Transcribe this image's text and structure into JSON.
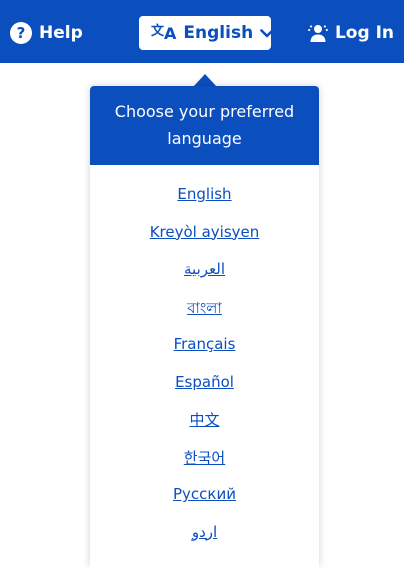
{
  "header": {
    "help_label": "Help",
    "help_icon": "question-circle-icon",
    "language_button_label": "English",
    "language_icon": "translate-icon",
    "login_label": "Log In",
    "login_icon": "user-icon"
  },
  "language_menu": {
    "heading": "Choose your preferred language",
    "languages": [
      "English",
      "Kreyòl ayisyen",
      "العربية",
      "বাংলা",
      "Français",
      "Español",
      "中文",
      "한국어",
      "Русский",
      "اردو"
    ]
  },
  "colors": {
    "brand_blue": "#0b4fbf",
    "white": "#ffffff"
  }
}
